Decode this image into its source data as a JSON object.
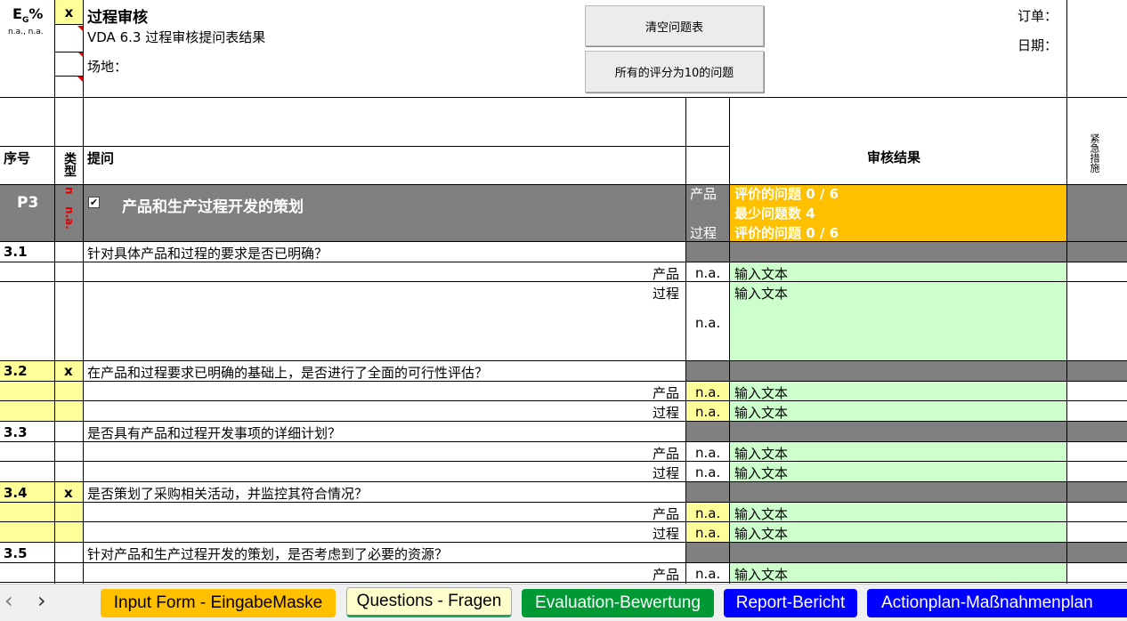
{
  "header": {
    "eg_symbol": "E",
    "eg_sub": "G",
    "eg_suffix": "%",
    "na_label": "n.a., n.a.",
    "x_mark": "x",
    "title": "过程审核",
    "subtitle": "VDA 6.3 过程审核提问表结果",
    "site_label": "场地：",
    "order_label": "订单：",
    "date_label": "日期：",
    "btn_clear": "清空问题表",
    "btn_all10": "所有的评分为10的问题"
  },
  "columns": {
    "no": "序号",
    "type": "类型",
    "question": "提问",
    "result": "审核结果",
    "urgent": "紧急措施"
  },
  "section": {
    "id": "P3",
    "title": "产品和生产过程开发的策划",
    "flag_n": "n",
    "flag_na": "n.a.",
    "product_label": "产品",
    "process_label": "过程",
    "eval_product": "评价的问题 0 /  6",
    "min_questions": "最少问题数 4",
    "eval_process": "评价的问题 0 /  6"
  },
  "questions": [
    {
      "no": "3.1",
      "type": "",
      "text": "针对具体产品和过程的要求是否已明确？",
      "p_label": "产品",
      "p_val": "n.a.",
      "p_text": "输入文本",
      "q_label": "过程",
      "q_val": "n.a.",
      "q_text": "输入文本"
    },
    {
      "no": "3.2",
      "type": "x",
      "text": "在产品和过程要求已明确的基础上，是否进行了全面的可行性评估？",
      "p_label": "产品",
      "p_val": "n.a.",
      "p_text": "输入文本",
      "q_label": "过程",
      "q_val": "n.a.",
      "q_text": "输入文本"
    },
    {
      "no": "3.3",
      "type": "",
      "text": "是否具有产品和过程开发事项的详细计划？",
      "p_label": "产品",
      "p_val": "n.a.",
      "p_text": "输入文本",
      "q_label": "过程",
      "q_val": "n.a.",
      "q_text": "输入文本"
    },
    {
      "no": "3.4",
      "type": "x",
      "text": "是否策划了采购相关活动，并监控其符合情况？",
      "p_label": "产品",
      "p_val": "n.a.",
      "p_text": "输入文本",
      "q_label": "过程",
      "q_val": "n.a.",
      "q_text": "输入文本"
    },
    {
      "no": "3.5",
      "type": "",
      "text": "针对产品和生产过程开发的策划，是否考虑到了必要的资源？",
      "p_label": "产品",
      "p_val": "n.a.",
      "p_text": "输入文本"
    }
  ],
  "tabs": [
    {
      "label": "Input Form - EingabeMaske",
      "color": "#ffc000",
      "text": "#000000"
    },
    {
      "label": "Questions - Fragen",
      "color": "#ffffcc",
      "text": "#000000"
    },
    {
      "label": "Evaluation-Bewertung",
      "color": "#009933",
      "text": "#ffffff"
    },
    {
      "label": "Report-Bericht",
      "color": "#0000ff",
      "text": "#ffffff"
    },
    {
      "label": "Actionplan-Maßnahmenplan",
      "color": "#0000ff",
      "text": "#ffffff"
    }
  ],
  "nav": {
    "prev": "‹",
    "next": "›"
  }
}
